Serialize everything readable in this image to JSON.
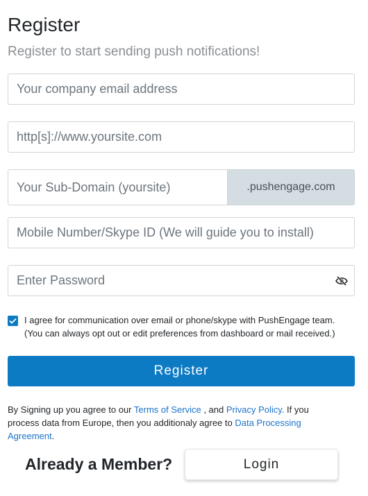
{
  "header": {
    "title": "Register",
    "subtitle": "Register to start sending push notifications!"
  },
  "form": {
    "email": {
      "placeholder": "Your company email address",
      "value": ""
    },
    "website": {
      "placeholder": "http[s]://www.yoursite.com",
      "value": ""
    },
    "subdomain": {
      "placeholder": "Your Sub-Domain (yoursite)",
      "value": "",
      "suffix": ".pushengage.com"
    },
    "mobile": {
      "placeholder": "Mobile Number/Skype ID (We will guide you to install)",
      "value": ""
    },
    "password": {
      "placeholder": "Enter Password",
      "value": "",
      "toggle_icon": "eye-slash-icon"
    },
    "agree": {
      "checked": true,
      "line1": "I agree for communication over email or phone/skype with PushEngage team.",
      "line2": "(You can always opt out or edit preferences from dashboard or mail received.)"
    },
    "register_label": "Register"
  },
  "terms": {
    "prefix": "By Signing up you agree to our ",
    "tos_link": "Terms of Service",
    "middle": " , and ",
    "privacy_link": "Privacy Policy.",
    "suffix": " If you process data from Europe, then you additionaly agree to ",
    "dpa_link": "Data Processing Agreement",
    "end": "."
  },
  "footer": {
    "member_label": "Already a Member?",
    "login_label": "Login"
  },
  "colors": {
    "accent": "#0d7ac4",
    "link": "#1a73c9",
    "suffix_bg": "#d3dde2"
  }
}
